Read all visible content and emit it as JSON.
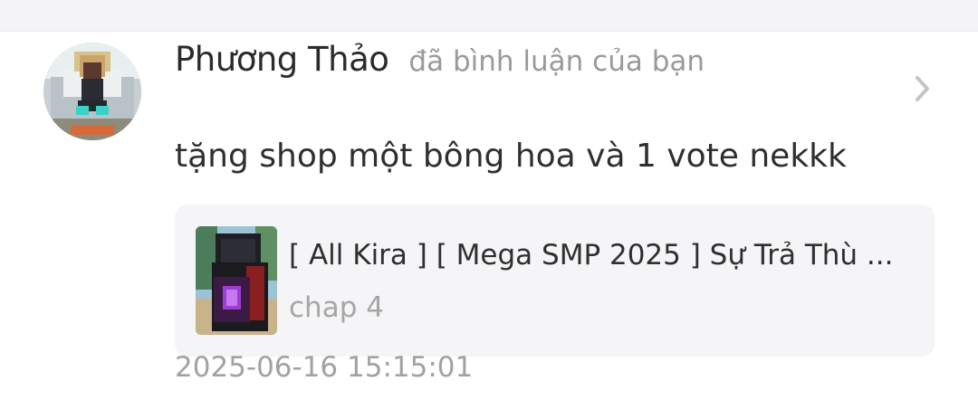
{
  "notification": {
    "user_name": "Phương Thảo",
    "action": "đã bình luận của bạn",
    "comment": "tặng shop một bông hoa và 1 vote nekkk",
    "timestamp": "2025-06-16 15:15:01",
    "avatar_icon": "user-avatar",
    "chevron_icon": "chevron-right-icon"
  },
  "story_card": {
    "title": "[ All Kira ] [ Mega SMP 2025 ] Sự Trả Thù ...",
    "chapter": "chap 4",
    "cover_icon": "story-cover"
  },
  "colors": {
    "name": "#2b2b2b",
    "secondary": "#9a9a9a",
    "card_background": "#f5f5f7",
    "top_band": "#f4f4f6"
  }
}
